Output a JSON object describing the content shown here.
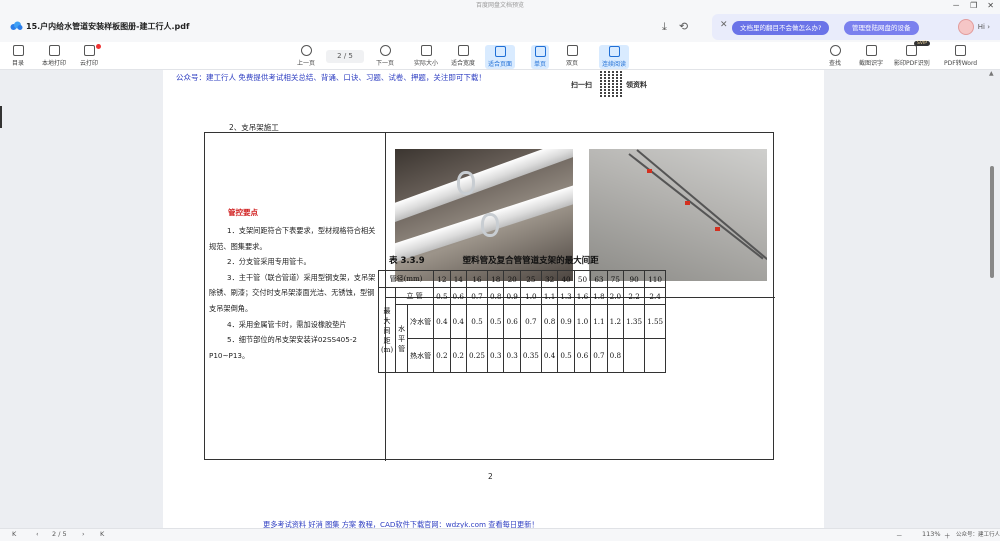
{
  "window": {
    "app_title": "百度网盘文档预览",
    "minimize": "－",
    "maximize": "❐",
    "close": "✕"
  },
  "filebar": {
    "file_name": "15.户内给水管道安装样板图册-建工行人.pdf",
    "download_icon": "download-icon",
    "share_icon": "share-icon",
    "promo_close": "✕",
    "promo_pill_1": "文档里的翻目不会做怎么办?",
    "promo_pill_2": "管理登陆网盘的设备",
    "hi_label": "Hi ›"
  },
  "toolbar": {
    "left": [
      {
        "label": "目录",
        "icon": "toc-icon"
      },
      {
        "label": "本地打印",
        "icon": "printer-icon"
      },
      {
        "label": "云打印",
        "icon": "cloud-print-icon"
      }
    ],
    "prev_label": "上一页",
    "page_indicator": "2 / 5",
    "next_label": "下一页",
    "view_modes": [
      {
        "label": "实际大小",
        "active": false
      },
      {
        "label": "适合宽度",
        "active": false
      },
      {
        "label": "适合页面",
        "active": true
      },
      {
        "label": "单页",
        "active": true
      },
      {
        "label": "双页",
        "active": false
      },
      {
        "label": "连续阅读",
        "active": true
      }
    ],
    "right": [
      {
        "label": "查找",
        "icon": "search-icon"
      },
      {
        "label": "截图识字",
        "icon": "ocr-icon"
      },
      {
        "label": "影印PDF识别",
        "icon": "pdf-scan-icon"
      },
      {
        "label": "PDF转Word",
        "icon": "pdf-word-icon"
      }
    ],
    "svip_badge": "SVIP"
  },
  "page": {
    "notice": "公众号：建工行人 免费提供考试相关总结、背诵、口诀、习题、试卷、押题，关注即可下载！",
    "qr_left": "扫一扫",
    "qr_right": "领资料",
    "section_title": "2、支吊架施工",
    "key_points_title": "管控要点",
    "key_points": [
      "1．支架间距符合下表要求，型材规格符合相关规范、图集要求。",
      "2．分支管采用专用管卡。",
      "3．主干管（联合管道）采用型钢支架，支吊架除锈、刷漆；交付时支吊架漆面光洁、无锈蚀，型钢支吊架倒角。",
      "4．采用金属管卡时，需加设橡胶垫片",
      "5．细节部位的吊支架安装详02SS405-2 P10~P13。"
    ],
    "photo_left_alt": "pipe-clamp-photo",
    "photo_right_alt": "ceiling-hanger-photo",
    "table_caption_no": "表 3.3.9",
    "table_caption": "塑料管及复合管管道支架的最大间距",
    "table": {
      "header_label": "管径(mm)",
      "diameters": [
        "12",
        "14",
        "16",
        "18",
        "20",
        "25",
        "32",
        "40",
        "50",
        "63",
        "75",
        "90",
        "110"
      ],
      "row_group_label": "最大间距(m)",
      "horizontal_label": "水平管",
      "rows": [
        {
          "label": "立 管",
          "values": [
            "0.5",
            "0.6",
            "0.7",
            "0.8",
            "0.9",
            "1.0",
            "1.1",
            "1.3",
            "1.6",
            "1.8",
            "2.0",
            "2.2",
            "2.4"
          ]
        },
        {
          "label": "冷水管",
          "values": [
            "0.4",
            "0.4",
            "0.5",
            "0.5",
            "0.6",
            "0.7",
            "0.8",
            "0.9",
            "1.0",
            "1.1",
            "1.2",
            "1.35",
            "1.55"
          ]
        },
        {
          "label": "热水管",
          "values": [
            "0.2",
            "0.2",
            "0.25",
            "0.3",
            "0.3",
            "0.35",
            "0.4",
            "0.5",
            "0.6",
            "0.7",
            "0.8",
            "",
            ""
          ]
        }
      ]
    },
    "page_number": "2",
    "footer_note": "更多考试资料 好消 图集 方案 教程，CAD软件下载官网：wdzyk.com 查看每日更新！"
  },
  "statusbar": {
    "first": "K",
    "prev": "‹",
    "page_indicator": "2 / 5",
    "next": "›",
    "last": "K",
    "zoom": "113%",
    "zoom_minus": "－",
    "zoom_plus": "＋",
    "watermark": "公众号：建工行人"
  }
}
